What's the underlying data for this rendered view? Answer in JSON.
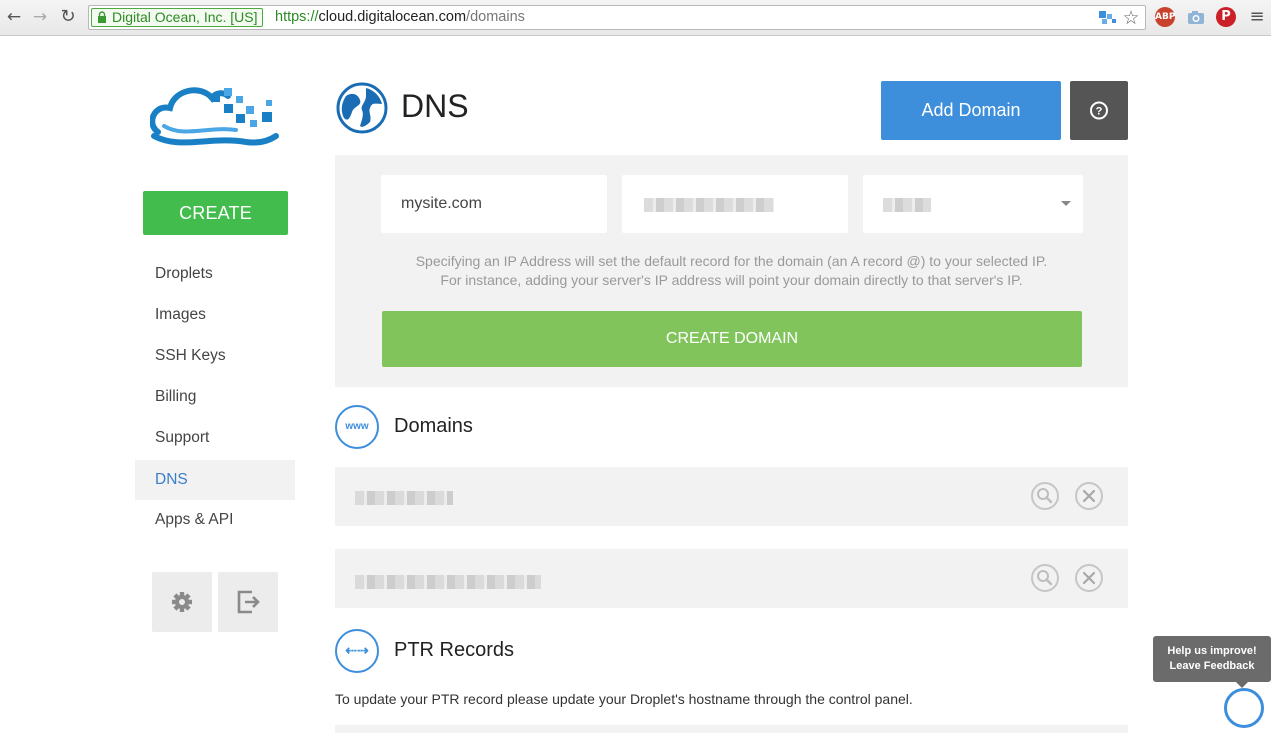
{
  "browser": {
    "ev_badge": "Digital Ocean, Inc. [US]",
    "url_scheme": "https://",
    "url_host": "cloud.digitalocean.com",
    "url_path": "/domains",
    "extension_abp": "ABP",
    "nav_back": "←",
    "nav_forward": "→",
    "nav_reload": "↻",
    "bookmark_star": "☆",
    "menu": "≡"
  },
  "sidebar": {
    "create_label": "CREATE",
    "items": [
      {
        "label": "Droplets"
      },
      {
        "label": "Images"
      },
      {
        "label": "SSH Keys"
      },
      {
        "label": "Billing"
      },
      {
        "label": "Support"
      },
      {
        "label": "DNS"
      },
      {
        "label": "Apps & API"
      }
    ],
    "active_item": "DNS"
  },
  "header": {
    "title": "DNS",
    "add_domain_label": "Add Domain",
    "help_label": "?"
  },
  "form": {
    "domain_value": "mysite.com",
    "ip_value_redacted": true,
    "droplet_select_redacted": true,
    "hint_line1": "Specifying an IP Address will set the default record for the domain (an A record @) to your selected IP.",
    "hint_line2": "For instance, adding your server's IP address will point your domain directly to that server's IP.",
    "submit_label": "CREATE DOMAIN"
  },
  "domains": {
    "icon_label": "www",
    "title": "Domains",
    "rows": [
      {
        "name_redacted": true
      },
      {
        "name_redacted": true
      }
    ]
  },
  "ptr": {
    "icon_label": "⇠⇢",
    "title": "PTR Records",
    "text": "To update your PTR record please update your Droplet's hostname through the control panel."
  },
  "feedback": {
    "line1": "Help us improve!",
    "line2": "Leave Feedback"
  },
  "colors": {
    "create_green": "#43bc4e",
    "create_domain_green": "#81c45c",
    "primary_blue": "#3d8edb",
    "active_nav": "#3b7dc9",
    "panel_gray": "#f2f2f2"
  }
}
